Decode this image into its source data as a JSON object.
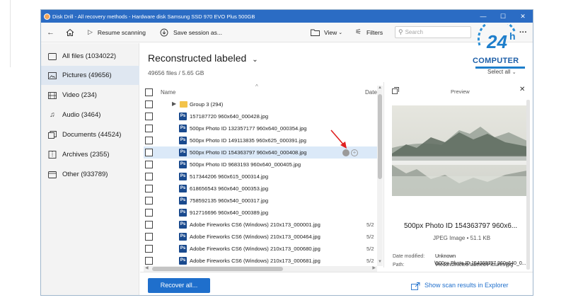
{
  "window": {
    "title": "Disk Drill - All recovery methods - Hardware disk Samsung SSD 970 EVO Plus 500GB",
    "minimize": "—",
    "maximize": "☐",
    "close": "✕"
  },
  "toolbar": {
    "resume_label": "Resume scanning",
    "save_label": "Save session as...",
    "view_label": "View",
    "filters_label": "Filters",
    "search_placeholder": "Search",
    "more": "···"
  },
  "watermark": {
    "line1": "24h",
    "line2": "COMPUTER",
    "select_all": "Select all"
  },
  "sidebar": {
    "items": [
      {
        "label": "All files (1034022)",
        "icon": "folder-icon"
      },
      {
        "label": "Pictures (49656)",
        "icon": "image-icon"
      },
      {
        "label": "Video (234)",
        "icon": "video-icon"
      },
      {
        "label": "Audio (3464)",
        "icon": "audio-icon"
      },
      {
        "label": "Documents (44524)",
        "icon": "document-icon"
      },
      {
        "label": "Archives (2355)",
        "icon": "archive-icon"
      },
      {
        "label": "Other (933789)",
        "icon": "other-icon"
      }
    ]
  },
  "main": {
    "title": "Reconstructed labeled",
    "subtitle": "49656 files / 5.65 GB",
    "col_name": "Name",
    "col_date": "Date",
    "group": "Group 3 (294)",
    "files": [
      {
        "name": "157187720 960x640_000428.jpg",
        "date": ""
      },
      {
        "name": "500px Photo ID 132357177 960x640_000354.jpg",
        "date": ""
      },
      {
        "name": "500px Photo ID 149113835 960x625_000391.jpg",
        "date": ""
      },
      {
        "name": "500px Photo ID 154363797 960x640_000408.jpg",
        "date": ""
      },
      {
        "name": "500px Photo ID 9683193 960x640_000405.jpg",
        "date": ""
      },
      {
        "name": "517344206 960x615_000314.jpg",
        "date": ""
      },
      {
        "name": "618656543 960x640_000353.jpg",
        "date": ""
      },
      {
        "name": "758592135 960x540_000317.jpg",
        "date": ""
      },
      {
        "name": "912716696 960x640_000389.jpg",
        "date": ""
      },
      {
        "name": "Adobe Fireworks CS6 (Windows) 210x173_000001.jpg",
        "date": "5/2"
      },
      {
        "name": "Adobe Fireworks CS6 (Windows) 210x173_000464.jpg",
        "date": "5/2"
      },
      {
        "name": "Adobe Fireworks CS6 (Windows) 210x173_000680.jpg",
        "date": "5/2"
      },
      {
        "name": "Adobe Fireworks CS6 (Windows) 210x173_000681.jpg",
        "date": "5/2"
      }
    ]
  },
  "preview": {
    "header": "Preview",
    "filename": "500px Photo ID 154363797 960x6...",
    "type_size": "JPEG Image • 51.1 KB",
    "date_label": "Date modified:",
    "date_value": "Unknown",
    "path_label": "Path:",
    "path_line1": "\\Reconstructed labeled\\Pictures\\jpg",
    "path_line2": "\\500px Photo ID 154363797 960x640_0..."
  },
  "footer": {
    "recover_label": "Recover all...",
    "explorer_label": "Show scan results in Explorer"
  },
  "colors": {
    "accent": "#1f6fcc",
    "titlebar": "#2b6cc4",
    "selected_row": "#dbe9f8",
    "annotation_arrow": "#e02020"
  }
}
